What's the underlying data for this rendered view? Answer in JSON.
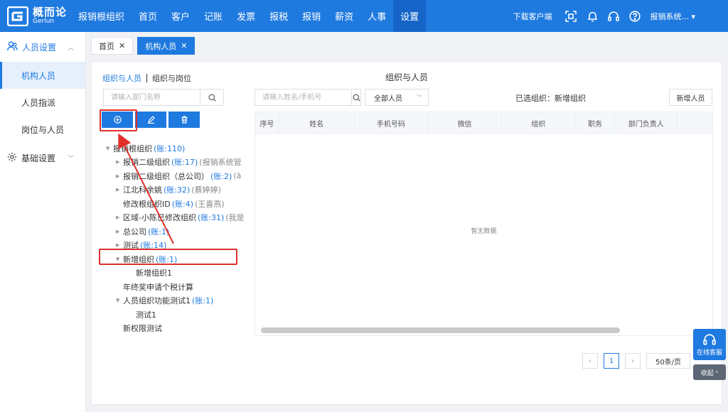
{
  "app": {
    "logo_cn": "概而论",
    "logo_en": "Gerlun",
    "nav": [
      "报销根组织",
      "首页",
      "客户",
      "记账",
      "发票",
      "报税",
      "报销",
      "薪资",
      "人事",
      "设置"
    ],
    "download_label": "下载客户端",
    "user_label": "报销系统...",
    "accent_color": "#1f7ae0"
  },
  "sidebar": {
    "group1": "人员设置",
    "items": [
      "机构人员",
      "人员指派",
      "岗位与人员"
    ],
    "group2": "基础设置"
  },
  "tabs": [
    {
      "label": "首页"
    },
    {
      "label": "机构人员"
    }
  ],
  "left_panel": {
    "tab_org_people": "组织与人员",
    "tab_org_post": "组织与岗位",
    "dept_placeholder": "请输入部门名称"
  },
  "tree": [
    {
      "level": 0,
      "expanded": true,
      "has_children": true,
      "name": "报销根组织",
      "count": "(账:110)",
      "manager": ""
    },
    {
      "level": 1,
      "expanded": false,
      "has_children": true,
      "name": "报销二级组织",
      "count": "(账:17)",
      "manager": "(报销系统管"
    },
    {
      "level": 1,
      "expanded": false,
      "has_children": true,
      "name": "报销二级组织（总公司）",
      "count": "(账:2)",
      "manager": "(ā"
    },
    {
      "level": 1,
      "expanded": false,
      "has_children": true,
      "name": "江北科余姚",
      "count": "(账:32)",
      "manager": "(蔡婷婷)"
    },
    {
      "level": 1,
      "expanded": false,
      "has_children": false,
      "name": "修改根组织ID",
      "count": "(账:4)",
      "manager": "(王喜燕)"
    },
    {
      "level": 1,
      "expanded": false,
      "has_children": true,
      "name": "区域-小陈已修改组织",
      "count": "(账:31)",
      "manager": "(我是"
    },
    {
      "level": 1,
      "expanded": false,
      "has_children": true,
      "name": "总公司",
      "count": "(账:1)",
      "manager": ""
    },
    {
      "level": 1,
      "expanded": false,
      "has_children": true,
      "name": "测试",
      "count": "(账:14)",
      "manager": ""
    },
    {
      "level": 1,
      "expanded": true,
      "has_children": true,
      "name": "新增组织",
      "count": "(账:1)",
      "manager": ""
    },
    {
      "level": 2,
      "expanded": false,
      "has_children": false,
      "name": "新增组织1",
      "count": "",
      "manager": ""
    },
    {
      "level": 1,
      "expanded": false,
      "has_children": false,
      "name": "年终奖申请个税计算",
      "count": "",
      "manager": ""
    },
    {
      "level": 1,
      "expanded": true,
      "has_children": true,
      "name": "人员组织功能测试1",
      "count": "(账:1)",
      "manager": ""
    },
    {
      "level": 2,
      "expanded": false,
      "has_children": false,
      "name": "测试1",
      "count": "",
      "manager": ""
    },
    {
      "level": 1,
      "expanded": false,
      "has_children": false,
      "name": "新权限测试",
      "count": "",
      "manager": ""
    }
  ],
  "right_panel": {
    "title": "组织与人员",
    "emp_placeholder": "请输入姓名/手机号",
    "emp_filter": "全部人员",
    "selected_org": "已选组织：新增组织",
    "add_button": "新增人员",
    "columns": [
      "序号",
      "姓名",
      "手机号码",
      "微信",
      "组织",
      "职务",
      "部门负责人"
    ],
    "empty_text": "暂无数据"
  },
  "pagination": {
    "current_page": "1",
    "page_size": "50条/页"
  },
  "service": {
    "online_label": "在线客服",
    "collapse_label": "收起"
  },
  "annotation_color": "#e0302b"
}
